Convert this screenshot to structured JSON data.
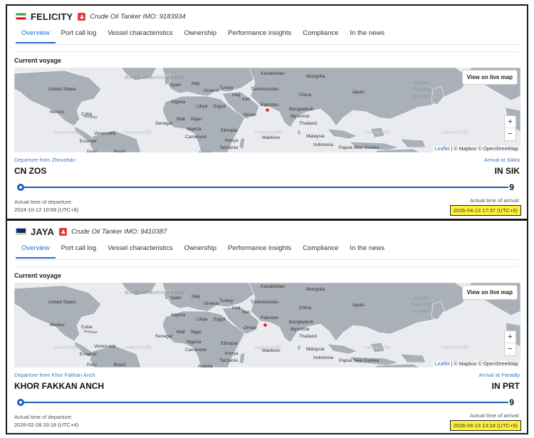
{
  "colors": {
    "accent": "#1f6ed1",
    "route": "#1a5fb4",
    "highlight": "#fff03a",
    "pin": "#e0302b",
    "water": "#e9ebee",
    "land": "#a9b0b8"
  },
  "vessels": [
    {
      "flag_icon": "iran-flag-icon",
      "name": "FELICITY",
      "type_label": "Crude Oil Tanker  IMO: 9183934",
      "tabs": [
        "Overview",
        "Port call log",
        "Vessel characteristics",
        "Ownership",
        "Performance insights",
        "Compliance",
        "In the news"
      ],
      "active_tab": "Overview",
      "section_title": "Current voyage",
      "map": {
        "live_button": "View on live map",
        "zoom_in": "+",
        "zoom_out": "−",
        "attribution_leaflet": "Leaflet",
        "attribution_rest": "| © Mapbox © OpenStreetMap",
        "watermark": "marinetraffic",
        "oceans": {
          "north_atlantic": "North Atlantic Ocean",
          "north_pacific": "North Pacific Ocean"
        },
        "labels": [
          "United States",
          "Mexico",
          "Cuba",
          "Venezuela",
          "Ecuador",
          "Peru",
          "Brazil",
          "Spain",
          "Italy",
          "Greece",
          "Algeria",
          "Libya",
          "Egypt",
          "Mali",
          "Niger",
          "Senegal",
          "Nigeria",
          "Cameroon",
          "Ethiopia",
          "Kenya",
          "Tanzania",
          "Angola",
          "Iraq",
          "Iran",
          "Turkey",
          "Oman",
          "Turkmenistan",
          "Kazakhstan",
          "Mongolia",
          "Pakistan",
          "Bangladesh",
          "China",
          "Japan",
          "Myanmar",
          "Thailand",
          "Maldives",
          "Malaysia",
          "Indonesia",
          "Papua New Guinea"
        ]
      },
      "departure": {
        "label": "Departure from Zhoushan",
        "code": "CN ZOS",
        "time_label": "Actual time of departure:",
        "time": "2024-10-12 10:59 (UTC+8)"
      },
      "arrival": {
        "label": "Arrival at Sikka",
        "code": "IN SIK",
        "time_label": "Actual time of arrival:",
        "time": "2026-04-13 17:37 (UTC+5)"
      },
      "end_marker": "9"
    },
    {
      "flag_icon": "curacao-flag-icon",
      "name": "JAYA",
      "type_label": "Crude Oil Tanker  IMO: 9410387",
      "tabs": [
        "Overview",
        "Port call log",
        "Vessel characteristics",
        "Ownership",
        "Performance insights",
        "Compliance",
        "In the news"
      ],
      "active_tab": "Overview",
      "section_title": "Current voyage",
      "map": {
        "live_button": "View on live map",
        "zoom_in": "+",
        "zoom_out": "−",
        "attribution_leaflet": "Leaflet",
        "attribution_rest": "| © Mapbox © OpenStreetMap",
        "watermark": "marinetraffic",
        "oceans": {
          "north_atlantic": "North Atlantic Ocean",
          "north_pacific": "North Pacific Ocean"
        },
        "labels": [
          "United States",
          "Mexico",
          "Cuba",
          "Venezuela",
          "Ecuador",
          "Peru",
          "Brazil",
          "Spain",
          "Italy",
          "Greece",
          "Algeria",
          "Libya",
          "Egypt",
          "Mali",
          "Niger",
          "Senegal",
          "Nigeria",
          "Cameroon",
          "Ethiopia",
          "Kenya",
          "Tanzania",
          "Angola",
          "Iraq",
          "Iran",
          "Turkey",
          "Oman",
          "Turkmenistan",
          "Kazakhstan",
          "Mongolia",
          "Pakistan",
          "Bangladesh",
          "China",
          "Japan",
          "Myanmar",
          "Thailand",
          "Maldives",
          "Malaysia",
          "Indonesia",
          "Papua New Guinea"
        ]
      },
      "departure": {
        "label": "Departure from Khor Fakkan Anch",
        "code": "KHOR FAKKAN ANCH",
        "time_label": "Actual time of departure:",
        "time": "2026-02-28 20:18 (UTC+4)"
      },
      "arrival": {
        "label": "Arrival at Paradip",
        "code": "IN PRT",
        "time_label": "Actual time of arrival:",
        "time": "2026-04-13 13:18 (UTC+5)"
      },
      "end_marker": "9"
    }
  ]
}
